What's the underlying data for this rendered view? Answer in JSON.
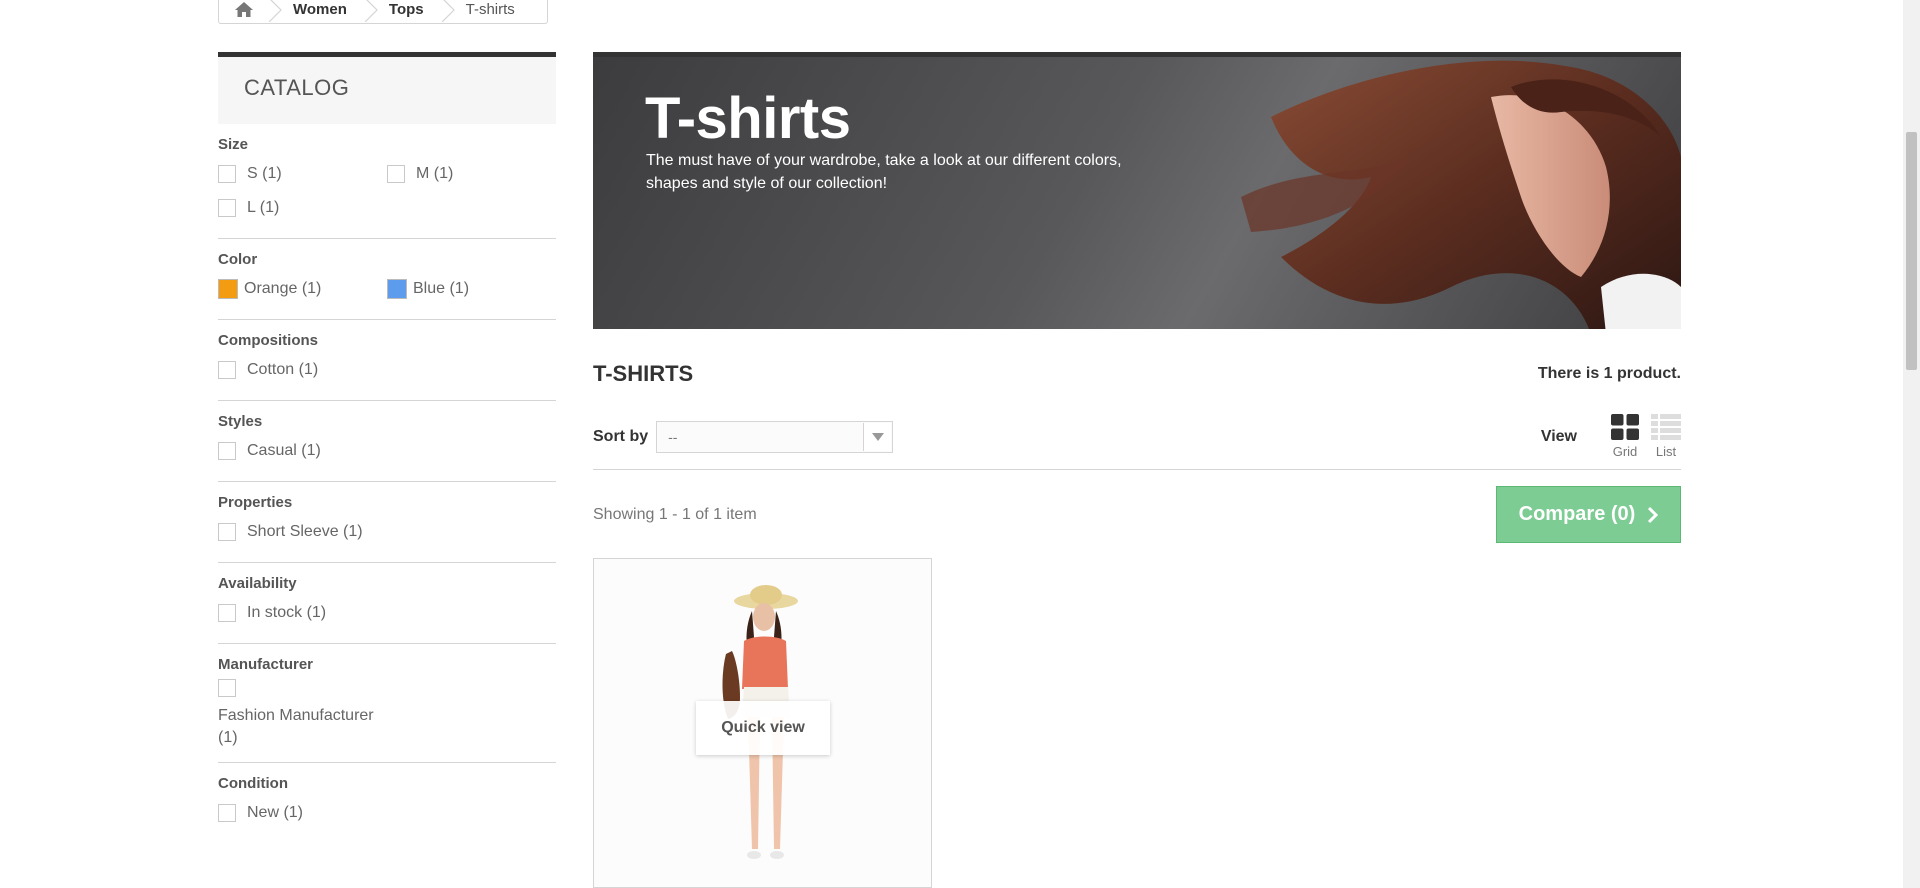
{
  "breadcrumb": {
    "home_icon": "home-icon",
    "items": [
      "Women",
      "Tops",
      "T-shirts"
    ]
  },
  "sidebar": {
    "title": "CATALOG",
    "filters": {
      "size": {
        "title": "Size",
        "options": [
          "S (1)",
          "M (1)",
          "L (1)"
        ]
      },
      "color": {
        "title": "Color",
        "options": [
          {
            "label": "Orange (1)",
            "color": "#f39c11"
          },
          {
            "label": "Blue (1)",
            "color": "#5d9cec"
          }
        ]
      },
      "compositions": {
        "title": "Compositions",
        "options": [
          "Cotton (1)"
        ]
      },
      "styles": {
        "title": "Styles",
        "options": [
          "Casual (1)"
        ]
      },
      "properties": {
        "title": "Properties",
        "options": [
          "Short Sleeve (1)"
        ]
      },
      "availability": {
        "title": "Availability",
        "options": [
          "In stock (1)"
        ]
      },
      "manufacturer": {
        "title": "Manufacturer",
        "options": [
          "Fashion Manufacturer (1)"
        ]
      },
      "condition": {
        "title": "Condition",
        "options": [
          "New (1)"
        ]
      }
    }
  },
  "banner": {
    "title": "T-shirts",
    "description": "The must have of your wardrobe, take a look at our different colors, shapes and style of our collection!"
  },
  "category": {
    "heading": "T-SHIRTS",
    "count_text": "There is 1 product."
  },
  "toolbar": {
    "sort_label": "Sort by",
    "sort_value": "--",
    "view_label": "View",
    "grid_label": "Grid",
    "list_label": "List"
  },
  "listing": {
    "showing_text": "Showing 1 - 1 of 1 item",
    "compare_label": "Compare (0)",
    "quick_view_label": "Quick view"
  },
  "colors": {
    "accent_green": "#7ccc93",
    "border": "#d6d4d4"
  }
}
